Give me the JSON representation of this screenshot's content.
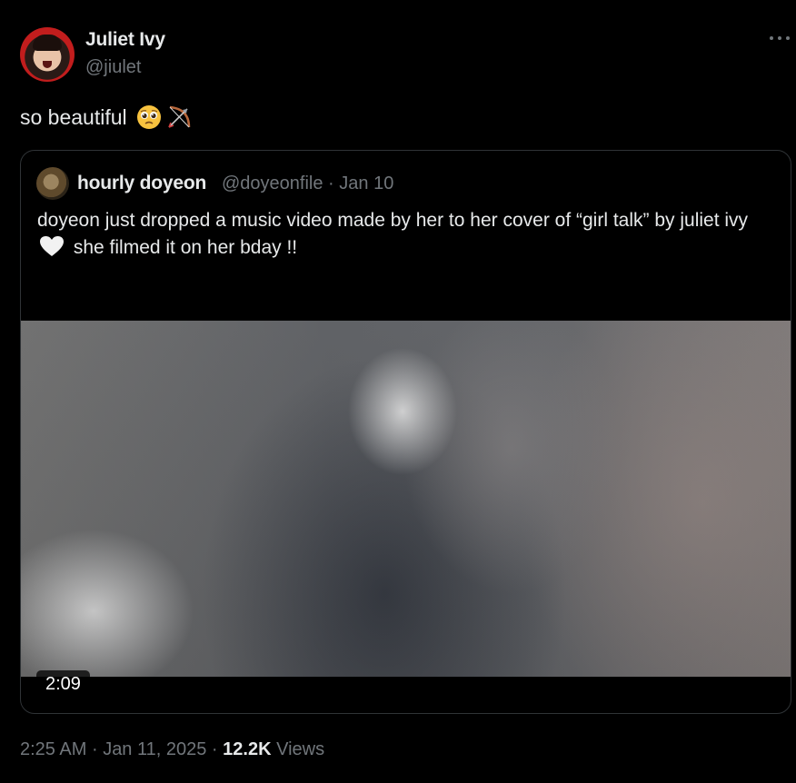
{
  "tweet": {
    "author": {
      "name": "Juliet Ivy",
      "handle": "@jiulet"
    },
    "text": "so beautiful",
    "emojis": [
      "pleading-face",
      "bow-and-arrow"
    ],
    "meta": {
      "time": "2:25 AM",
      "separator_1": "·",
      "date": "Jan 11, 2025",
      "separator_2": "·",
      "views_count": "12.2K",
      "views_label": "Views"
    }
  },
  "quoted_tweet": {
    "author": {
      "name": "hourly doyeon",
      "handle": "@doyeonfile",
      "separator": "·",
      "date": "Jan 10"
    },
    "text_before_heart": "doyeon just dropped a music video made by her to her cover of “girl talk” by juliet ivy",
    "text_after_heart": "she filmed it on her bday !!",
    "video": {
      "duration": "2:09"
    }
  },
  "colors": {
    "background": "#000000",
    "primary_text": "#e7e9ea",
    "secondary_text": "#71767b",
    "border": "#2f3336"
  },
  "icons": [
    "more-icon",
    "heart-icon"
  ]
}
